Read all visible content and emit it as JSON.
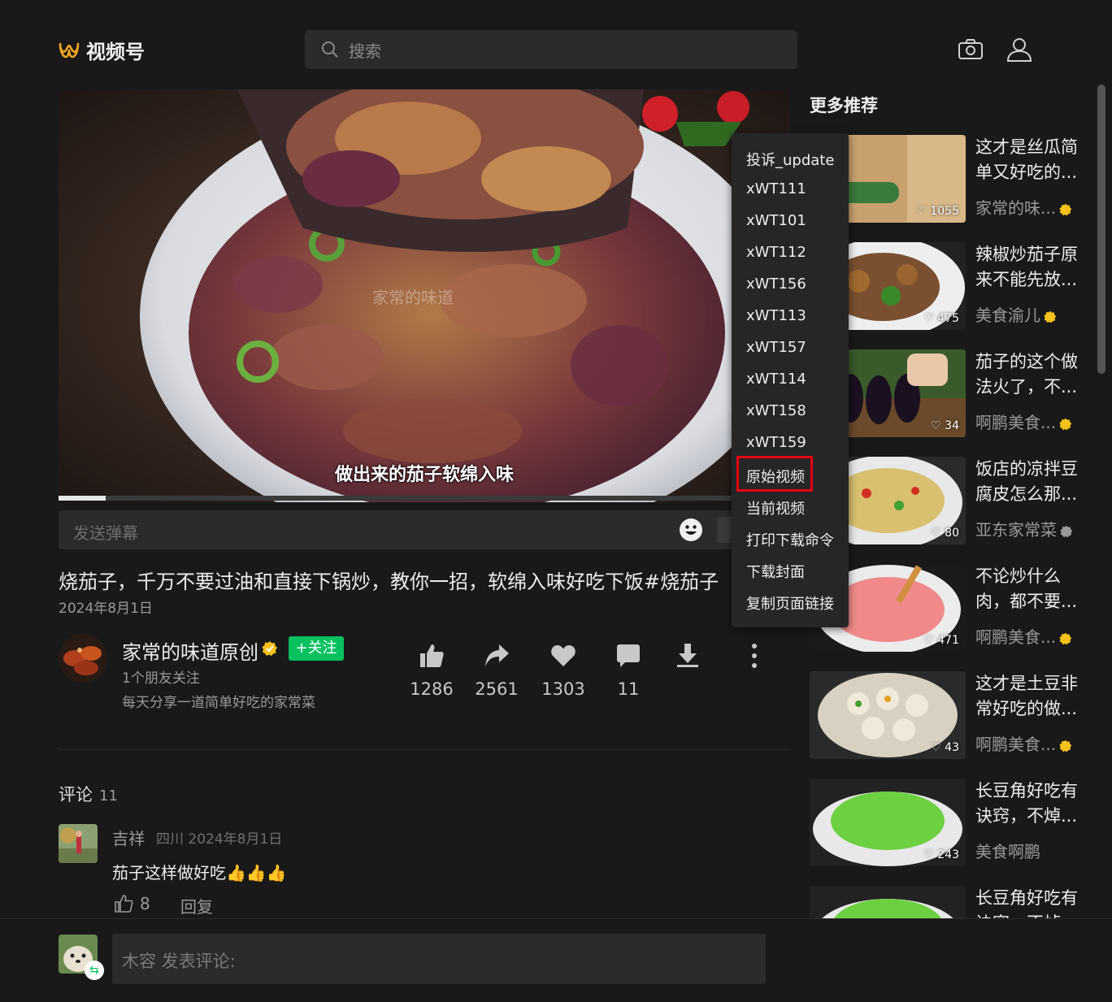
{
  "header": {
    "logo_text": "视频号",
    "search_placeholder": "搜索"
  },
  "video": {
    "caption": "做出来的茄子软绵入味",
    "watermark": "家常的味道",
    "progress": 0.064,
    "danmaku_placeholder": "发送弹幕"
  },
  "post": {
    "title": "烧茄子，千万不要过油和直接下锅炒，教你一招，软绵入味好吃下饭",
    "hashtag": "#烧茄子",
    "date": "2024年8月1日"
  },
  "author": {
    "name": "家常的味道原创",
    "follow_label": "+关注",
    "friends": "1个朋友关注",
    "bio": "每天分享一道简单好吃的家常菜"
  },
  "actions": {
    "like": "1286",
    "share": "2561",
    "favorite": "1303",
    "comment": "11"
  },
  "comments": {
    "title": "评论",
    "count": "11",
    "items": [
      {
        "user": "吉祥",
        "meta": "四川 2024年8月1日",
        "text": "茄子这样做好吃👍👍👍",
        "likes": "8",
        "reply_label": "回复"
      }
    ],
    "input_placeholder": "木容 发表评论:"
  },
  "menu": {
    "items": [
      "投诉_update",
      "xWT111",
      "xWT101",
      "xWT112",
      "xWT156",
      "xWT113",
      "xWT157",
      "xWT114",
      "xWT158",
      "xWT159",
      "原始视频",
      "当前视频",
      "打印下载命令",
      "下载封面",
      "复制页面链接"
    ],
    "highlighted": "原始视频"
  },
  "recommendations": {
    "title": "更多推荐",
    "items": [
      {
        "title": "这才是丝瓜简单又好吃的...",
        "author": "家常的味...",
        "likes": "1055",
        "verified": "gold"
      },
      {
        "title": "辣椒炒茄子原来不能先放...",
        "author": "美食渝儿",
        "likes": "475",
        "verified": "gold"
      },
      {
        "title": "茄子的这个做法火了，不...",
        "author": "啊鹏美食...",
        "likes": "34",
        "verified": "gold"
      },
      {
        "title": "饭店的凉拌豆腐皮怎么那...",
        "author": "亚东家常菜",
        "likes": "80",
        "verified": "gray"
      },
      {
        "title": "不论炒什么肉，都不要...",
        "author": "啊鹏美食...",
        "likes": "471",
        "verified": "gold"
      },
      {
        "title": "这才是土豆非常好吃的做...",
        "author": "啊鹏美食...",
        "likes": "43",
        "verified": "gold"
      },
      {
        "title": "长豆角好吃有诀窍，不焯...",
        "author": "美食啊鹏",
        "likes": "243",
        "verified": "none"
      },
      {
        "title": "长豆角好吃有诀窍，不焯...",
        "author": "",
        "likes": "",
        "verified": "none"
      }
    ]
  },
  "colors": {
    "background": "#191919",
    "accent_green": "#07c160",
    "logo_orange": "#f5a623",
    "highlight_red": "#e60012",
    "verified_gold": "#f7c21c"
  }
}
